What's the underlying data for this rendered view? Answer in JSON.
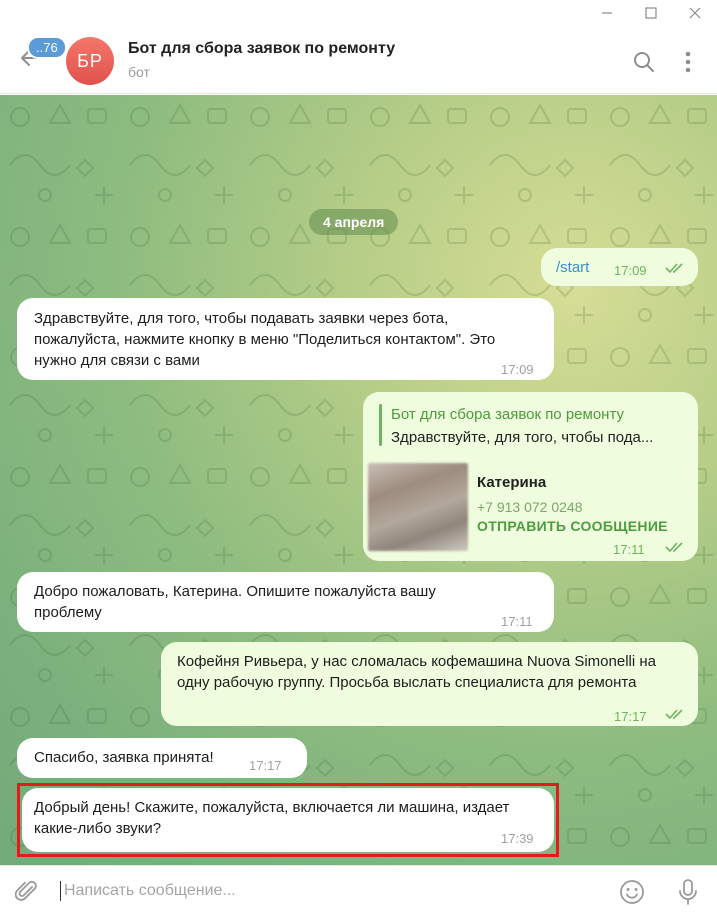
{
  "window": {
    "controls": [
      "minimize",
      "maximize",
      "close"
    ]
  },
  "header": {
    "unread_count": "..76",
    "avatar_initials": "БР",
    "title": "Бот для сбора заявок по ремонту",
    "subtitle": "бот",
    "icons": [
      "back-arrow-icon",
      "search-icon",
      "more-vertical-icon"
    ]
  },
  "chat": {
    "date_separator": "4 апреля",
    "messages": [
      {
        "direction": "out",
        "text": "/start",
        "time": "17:09",
        "read": true
      },
      {
        "direction": "in",
        "text": "Здравствуйте, для того, чтобы подавать заявки через бота, пожалуйста, нажмите кнопку в меню \"Поделиться контактом\". Это нужно для связи с вами",
        "time": "17:09"
      },
      {
        "direction": "out",
        "type": "contact",
        "reply_to": {
          "author": "Бот для сбора заявок по ремонту",
          "text": "Здравствуйте, для того, чтобы пода..."
        },
        "contact": {
          "name": "Катерина",
          "phone": "+7 913 072 0248",
          "action": "ОТПРАВИТЬ СООБЩЕНИЕ"
        },
        "time": "17:11",
        "read": true
      },
      {
        "direction": "in",
        "text": "Добро пожаловать, Катерина. Опишите пожалуйста вашу проблему",
        "time": "17:11"
      },
      {
        "direction": "out",
        "text": "Кофейня Ривьера, у нас сломалась кофемашина Nuova Simonelli на одну рабочую группу. Просьба выслать специалиста для ремонта",
        "time": "17:17",
        "read": true
      },
      {
        "direction": "in",
        "text": "Спасибо, заявка принята!",
        "time": "17:17"
      },
      {
        "direction": "in",
        "text": "Добрый день! Скажите, пожалуйста, включается ли машина, издает какие-либо звуки?",
        "time": "17:39",
        "highlighted": true
      }
    ]
  },
  "input": {
    "placeholder": "Написать сообщение...",
    "value": "",
    "icons": [
      "attach-icon",
      "emoji-icon",
      "microphone-icon"
    ]
  },
  "colors": {
    "accent": "#5a9bd8",
    "outgoing_bubble": "#effdde",
    "incoming_bubble": "#ffffff",
    "outgoing_meta": "#6fb25f",
    "highlight_border": "#e51b1b"
  }
}
